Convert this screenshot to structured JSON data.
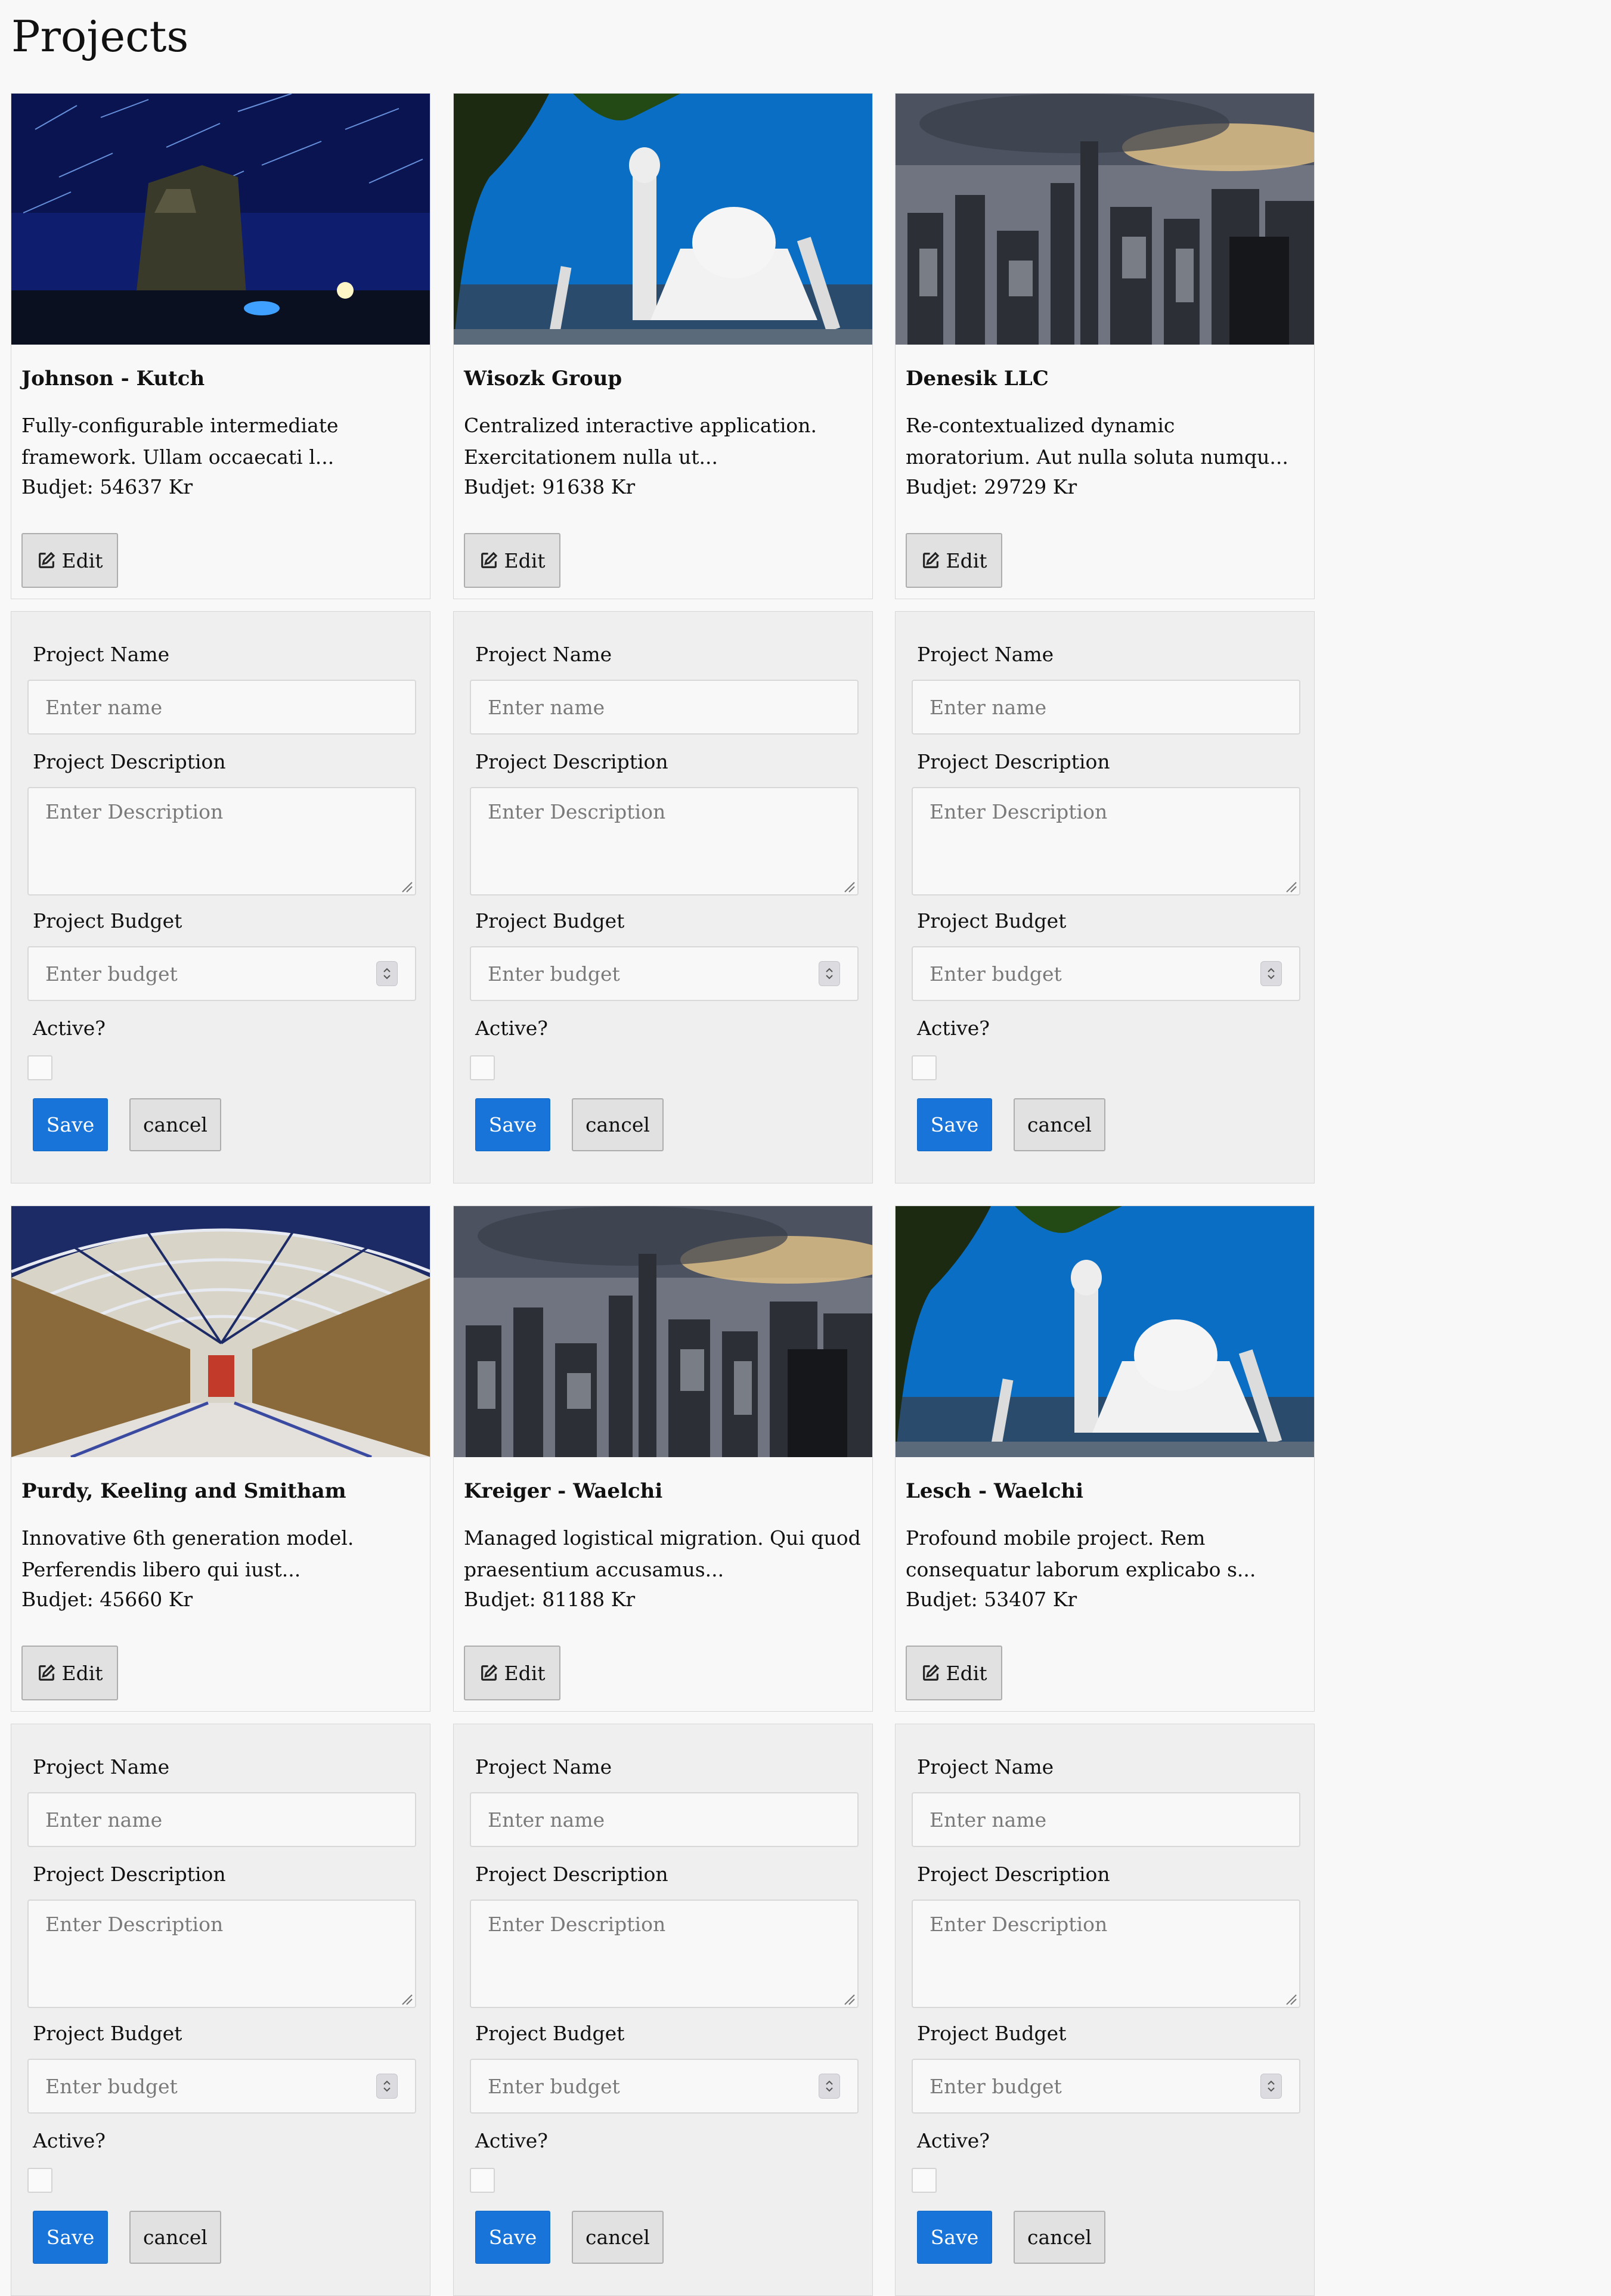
{
  "page": {
    "title": "Projects"
  },
  "form_labels": {
    "name_label": "Project Name",
    "name_placeholder": "Enter name",
    "description_label": "Project Description",
    "description_placeholder": "Enter Description",
    "budget_label": "Project Budget",
    "budget_placeholder": "Enter budget",
    "active_label": "Active?",
    "save_label": "Save",
    "cancel_label": "cancel",
    "edit_label": "Edit"
  },
  "projects": [
    {
      "name": "Johnson - Kutch",
      "description": "Fully-configurable intermediate framework. Ullam occaecati l...",
      "budget": "Budjet: 54637 Kr",
      "image": "night-tower-star-trails",
      "active": false
    },
    {
      "name": "Wisozk Group",
      "description": "Centralized interactive application. Exercitationem nulla ut...",
      "budget": "Budjet: 91638 Kr",
      "image": "taj-mahal",
      "active": false
    },
    {
      "name": "Denesik LLC",
      "description": "Re-contextualized dynamic moratorium. Aut nulla soluta numqu...",
      "budget": "Budjet: 29729 Kr",
      "image": "city-skyline",
      "active": false
    },
    {
      "name": "Purdy, Keeling and Smitham",
      "description": "Innovative 6th generation model. Perferendis libero qui iust...",
      "budget": "Budjet: 45660 Kr",
      "image": "arcade-hall",
      "active": false
    },
    {
      "name": "Kreiger - Waelchi",
      "description": "Managed logistical migration. Qui quod praesentium accusamus...",
      "budget": "Budjet: 81188 Kr",
      "image": "city-skyline",
      "active": false
    },
    {
      "name": "Lesch - Waelchi",
      "description": "Profound mobile project. Rem consequatur laborum explicabo s...",
      "budget": "Budjet: 53407 Kr",
      "image": "taj-mahal",
      "active": false
    }
  ],
  "colors": {
    "primary": "#1874d8",
    "page_bg": "#f8f8f8",
    "form_bg": "#efefef"
  }
}
